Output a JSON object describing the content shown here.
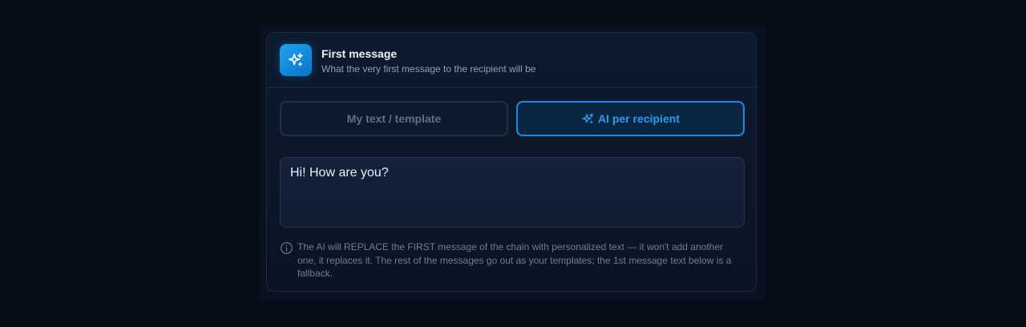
{
  "header": {
    "icon": "sparkles-icon",
    "title": "First message",
    "subtitle": "What the very first message to the recipient will be"
  },
  "mode_toggle": {
    "options": [
      {
        "label": "My text / template",
        "selected": false
      },
      {
        "label": "AI per recipient",
        "selected": true,
        "icon": "sparkles-icon"
      }
    ]
  },
  "message": {
    "value": "Hi! How are you?"
  },
  "info": {
    "icon": "info-circle-icon",
    "text": "The AI will REPLACE the FIRST message of the chain with personalized text — it won't add another one, it replaces it. The rest of the messages go out as your templates; the 1st message text below is a fallback."
  },
  "colors": {
    "accent": "#1a8ce0",
    "background": "#070d18",
    "card": "#0b1628"
  }
}
